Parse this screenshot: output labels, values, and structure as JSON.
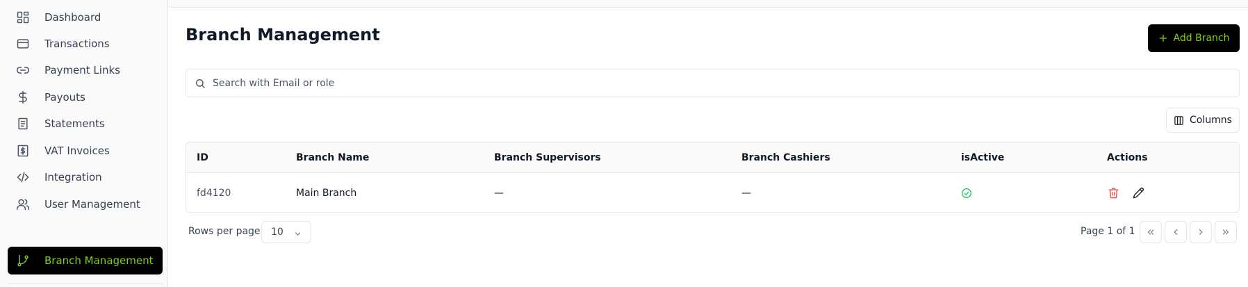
{
  "sidebar": {
    "items": [
      {
        "label": "Dashboard",
        "icon": "dashboard-icon"
      },
      {
        "label": "Transactions",
        "icon": "credit-card-icon"
      },
      {
        "label": "Payment Links",
        "icon": "link-icon"
      },
      {
        "label": "Payouts",
        "icon": "dollar-icon"
      },
      {
        "label": "Statements",
        "icon": "document-icon"
      },
      {
        "label": "VAT Invoices",
        "icon": "receipt-icon"
      },
      {
        "label": "Integration",
        "icon": "code-icon"
      },
      {
        "label": "User Management",
        "icon": "users-icon"
      },
      {
        "label": "Branch Management",
        "icon": "git-branch-icon",
        "active": true
      }
    ]
  },
  "main": {
    "title": "Branch Management",
    "add_button_label": "Add Branch",
    "search_placeholder": "Search with Email or role",
    "columns_button_label": "Columns"
  },
  "table": {
    "headers": [
      "ID",
      "Branch Name",
      "Branch Supervisors",
      "Branch Cashiers",
      "isActive",
      "Actions"
    ],
    "rows": [
      {
        "id": "fd4120",
        "branch_name": "Main Branch",
        "supervisors": "—",
        "cashiers": "—",
        "is_active": true
      }
    ]
  },
  "pagination": {
    "rows_per_page_label": "Rows per page",
    "rows_per_page_value": "10",
    "page_info": "Page 1 of 1"
  },
  "colors": {
    "accent": "#84cc16",
    "active_bg": "#000000",
    "success": "#22c55e",
    "danger": "#ef4444"
  }
}
